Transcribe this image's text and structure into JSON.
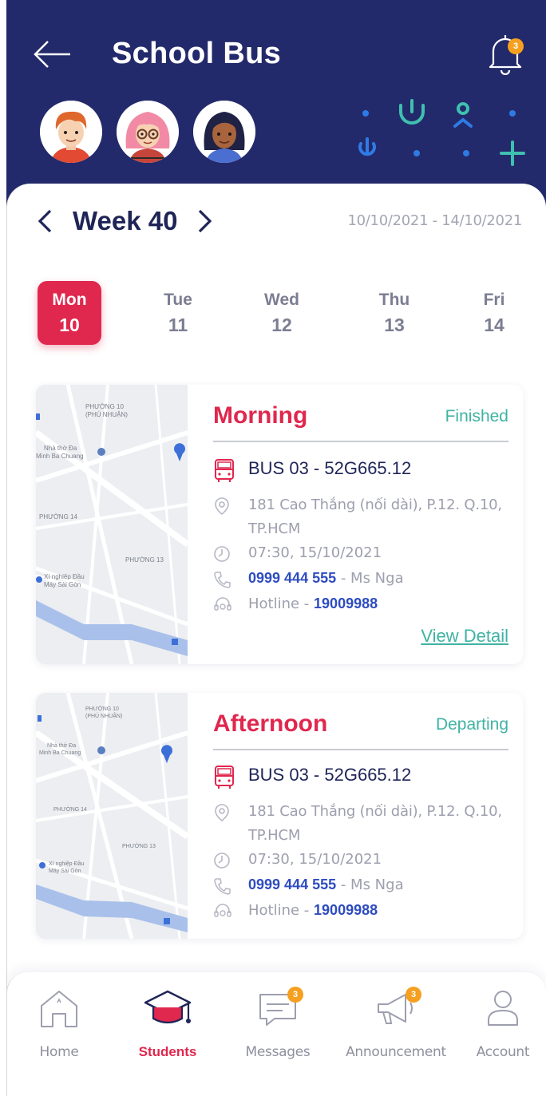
{
  "header": {
    "title": "School Bus",
    "notification_count": "3"
  },
  "students": [
    {
      "name": "student-boy"
    },
    {
      "name": "student-girl-glasses"
    },
    {
      "name": "student-girl"
    }
  ],
  "week": {
    "label": "Week 40",
    "date_range": "10/10/2021 - 14/10/2021"
  },
  "days": [
    {
      "name": "Mon",
      "num": "10",
      "active": true
    },
    {
      "name": "Tue",
      "num": "11",
      "active": false
    },
    {
      "name": "Wed",
      "num": "12",
      "active": false
    },
    {
      "name": "Thu",
      "num": "13",
      "active": false
    },
    {
      "name": "Fri",
      "num": "14",
      "active": false
    }
  ],
  "trips": [
    {
      "title": "Morning",
      "status": "Finished",
      "bus": "BUS 03 - 52G665.12",
      "address": "181 Cao Thắng (nối dài), P.12. Q.10, TP.HCM",
      "time": "07:30, 15/10/2021",
      "phone": "0999 444 555",
      "contact": " - Ms Nga",
      "hotline_label": "Hotline - ",
      "hotline": "19009988",
      "view_detail": "View Detail"
    },
    {
      "title": "Afternoon",
      "status": "Departing",
      "bus": "BUS 03 - 52G665.12",
      "address": "181 Cao Thắng (nối dài), P.12. Q.10, TP.HCM",
      "time": "07:30, 15/10/2021",
      "phone": "0999 444 555",
      "contact": " - Ms Nga",
      "hotline_label": "Hotline - ",
      "hotline": "19009988"
    }
  ],
  "map_labels": {
    "ward_10": "PHƯỜNG 10",
    "phu_nhuan": "(PHÚ NHUẬN)",
    "church_1": "Nhà thờ Đa",
    "church_2": "Minh Ba Chuang",
    "ward_14": "PHƯỜNG 14",
    "ward_13": "PHƯỜNG 13",
    "factory_1": "Xí nghiệp Đầu",
    "factory_2": "Máy Sài Gòn"
  },
  "nav": {
    "items": [
      {
        "label": "Home",
        "icon": "home-icon"
      },
      {
        "label": "Students",
        "icon": "graduation-cap-icon"
      },
      {
        "label": "Messages",
        "icon": "message-icon",
        "badge": "3"
      },
      {
        "label": "Announcement",
        "icon": "megaphone-icon",
        "badge": "3"
      },
      {
        "label": "Account",
        "icon": "user-icon"
      }
    ]
  },
  "colors": {
    "header_bg": "#232a6b",
    "accent_red": "#e0274e",
    "teal": "#3fb3a3",
    "link_blue": "#2e4cc0",
    "badge_orange": "#f5a020"
  }
}
